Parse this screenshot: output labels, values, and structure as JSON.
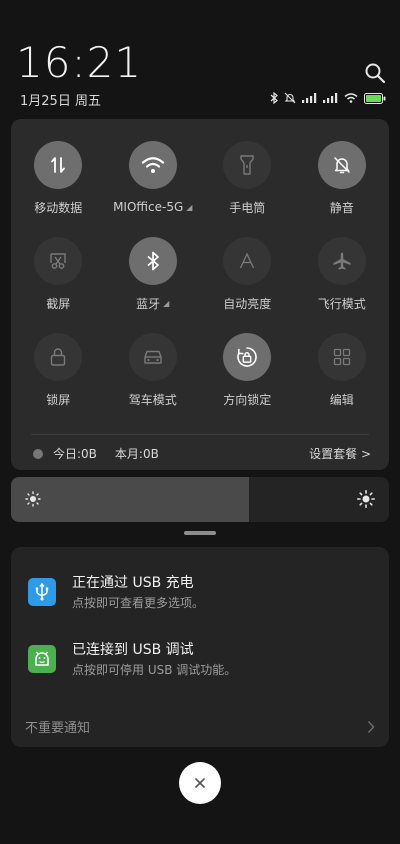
{
  "status": {
    "time": "16:21",
    "date": "1月25日 周五",
    "icons": [
      "bluetooth-icon",
      "mute-icon",
      "signal-icon",
      "signal-icon",
      "wifi-icon",
      "battery-icon"
    ],
    "battery_color": "#6ed85a"
  },
  "quick_settings": {
    "tiles": [
      {
        "id": "mobile-data",
        "label": "移动数据",
        "icon": "data-arrows-icon",
        "on": true
      },
      {
        "id": "wifi",
        "label": "MIOffice-5G",
        "icon": "wifi-icon",
        "on": true,
        "has_more": true
      },
      {
        "id": "flashlight",
        "label": "手电筒",
        "icon": "flashlight-icon",
        "on": false
      },
      {
        "id": "mute",
        "label": "静音",
        "icon": "bell-off-icon",
        "on": true
      },
      {
        "id": "screenshot",
        "label": "截屏",
        "icon": "scissors-icon",
        "on": false
      },
      {
        "id": "bluetooth",
        "label": "蓝牙",
        "icon": "bluetooth-icon",
        "on": true,
        "has_more": true
      },
      {
        "id": "auto-brightness",
        "label": "自动亮度",
        "icon": "auto-a-icon",
        "on": false
      },
      {
        "id": "airplane",
        "label": "飞行模式",
        "icon": "airplane-icon",
        "on": false
      },
      {
        "id": "lock-screen",
        "label": "锁屏",
        "icon": "lock-icon",
        "on": false
      },
      {
        "id": "driving-mode",
        "label": "驾车模式",
        "icon": "car-icon",
        "on": false
      },
      {
        "id": "rotation-lock",
        "label": "方向锁定",
        "icon": "rotation-lock-icon",
        "on": true
      },
      {
        "id": "edit",
        "label": "编辑",
        "icon": "grid-icon",
        "on": false
      }
    ],
    "usage": {
      "today": "今日:0B",
      "month": "本月:0B",
      "plan_link": "设置套餐 >"
    }
  },
  "brightness": {
    "level": 0.63
  },
  "notifications": {
    "items": [
      {
        "title": "正在通过 USB 充电",
        "body": "点按即可查看更多选项。",
        "icon": "usb-icon",
        "icon_color": "#2f9be8"
      },
      {
        "title": "已连接到 USB 调试",
        "body": "点按即可停用 USB 调试功能。",
        "icon": "android-icon",
        "icon_color": "#4caf50"
      }
    ],
    "unimportant_label": "不重要通知"
  },
  "close_button": {
    "icon": "close-icon"
  }
}
